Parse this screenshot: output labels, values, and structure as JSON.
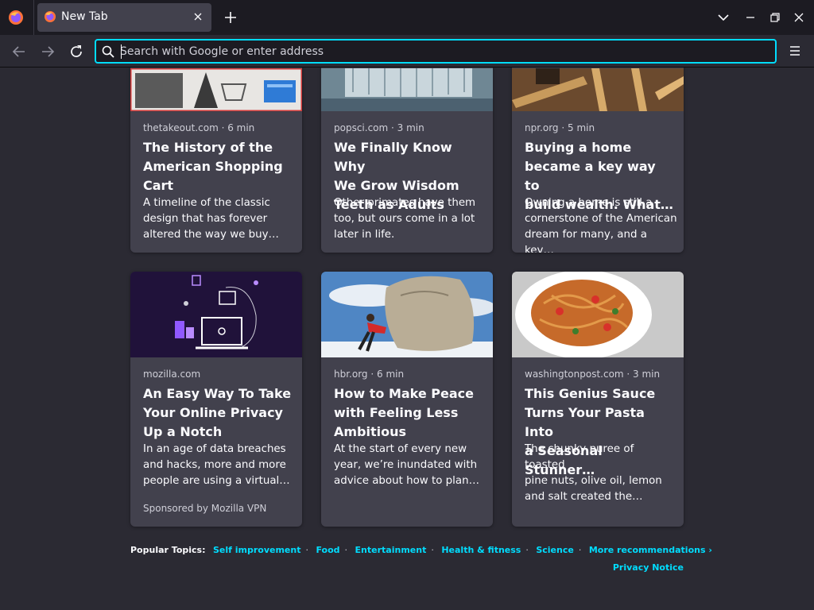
{
  "browser": {
    "tab_title": "New Tab",
    "url_placeholder": "Search with Google or enter address"
  },
  "colors": {
    "accent": "#00ddff",
    "card_bg": "#42414d",
    "page_bg": "#2b2a33",
    "toolbar_bg": "#1c1b22"
  },
  "stories": [
    {
      "source": "thetakeout.com · 6 min",
      "title": [
        "The History of the",
        "American Shopping",
        "Cart"
      ],
      "excerpt": [
        "A timeline of the classic",
        "design that has forever",
        "altered the way we buy…"
      ]
    },
    {
      "source": "popsci.com · 3 min",
      "title": [
        "We Finally Know Why",
        "We Grow Wisdom",
        "Teeth as Adults"
      ],
      "excerpt": [
        "Other primates have them",
        "too, but ours come in a lot",
        "later in life."
      ]
    },
    {
      "source": "npr.org · 5 min",
      "title": [
        "Buying a home",
        "became a key way to",
        "build wealth. What…"
      ],
      "excerpt": [
        "Owning a home is still a",
        "cornerstone of the American",
        "dream for many, and a key…"
      ]
    },
    {
      "source": "mozilla.com",
      "title": [
        "An Easy Way To Take",
        "Your Online Privacy",
        "Up a Notch"
      ],
      "excerpt": [
        "In an age of data breaches",
        "and hacks, more and more",
        "people are using a virtual…"
      ],
      "sponsor": "Sponsored by Mozilla VPN"
    },
    {
      "source": "hbr.org · 6 min",
      "title": [
        "How to Make Peace",
        "with Feeling Less",
        "Ambitious"
      ],
      "excerpt": [
        "At the start of every new",
        "year, we’re inundated with",
        "advice about how to plan…"
      ]
    },
    {
      "source": "washingtonpost.com · 3 min",
      "title": [
        "This Genius Sauce",
        "Turns Your Pasta Into",
        "a Seasonal Stunner…"
      ],
      "excerpt": [
        "The chunky puree of toasted",
        "pine nuts, olive oil, lemon",
        "and salt created the…"
      ]
    }
  ],
  "topics": {
    "label": "Popular Topics:",
    "items": [
      "Self improvement",
      "Food",
      "Entertainment",
      "Health & fitness",
      "Science",
      "More recommendations ›"
    ]
  },
  "privacy_notice": "Privacy Notice"
}
